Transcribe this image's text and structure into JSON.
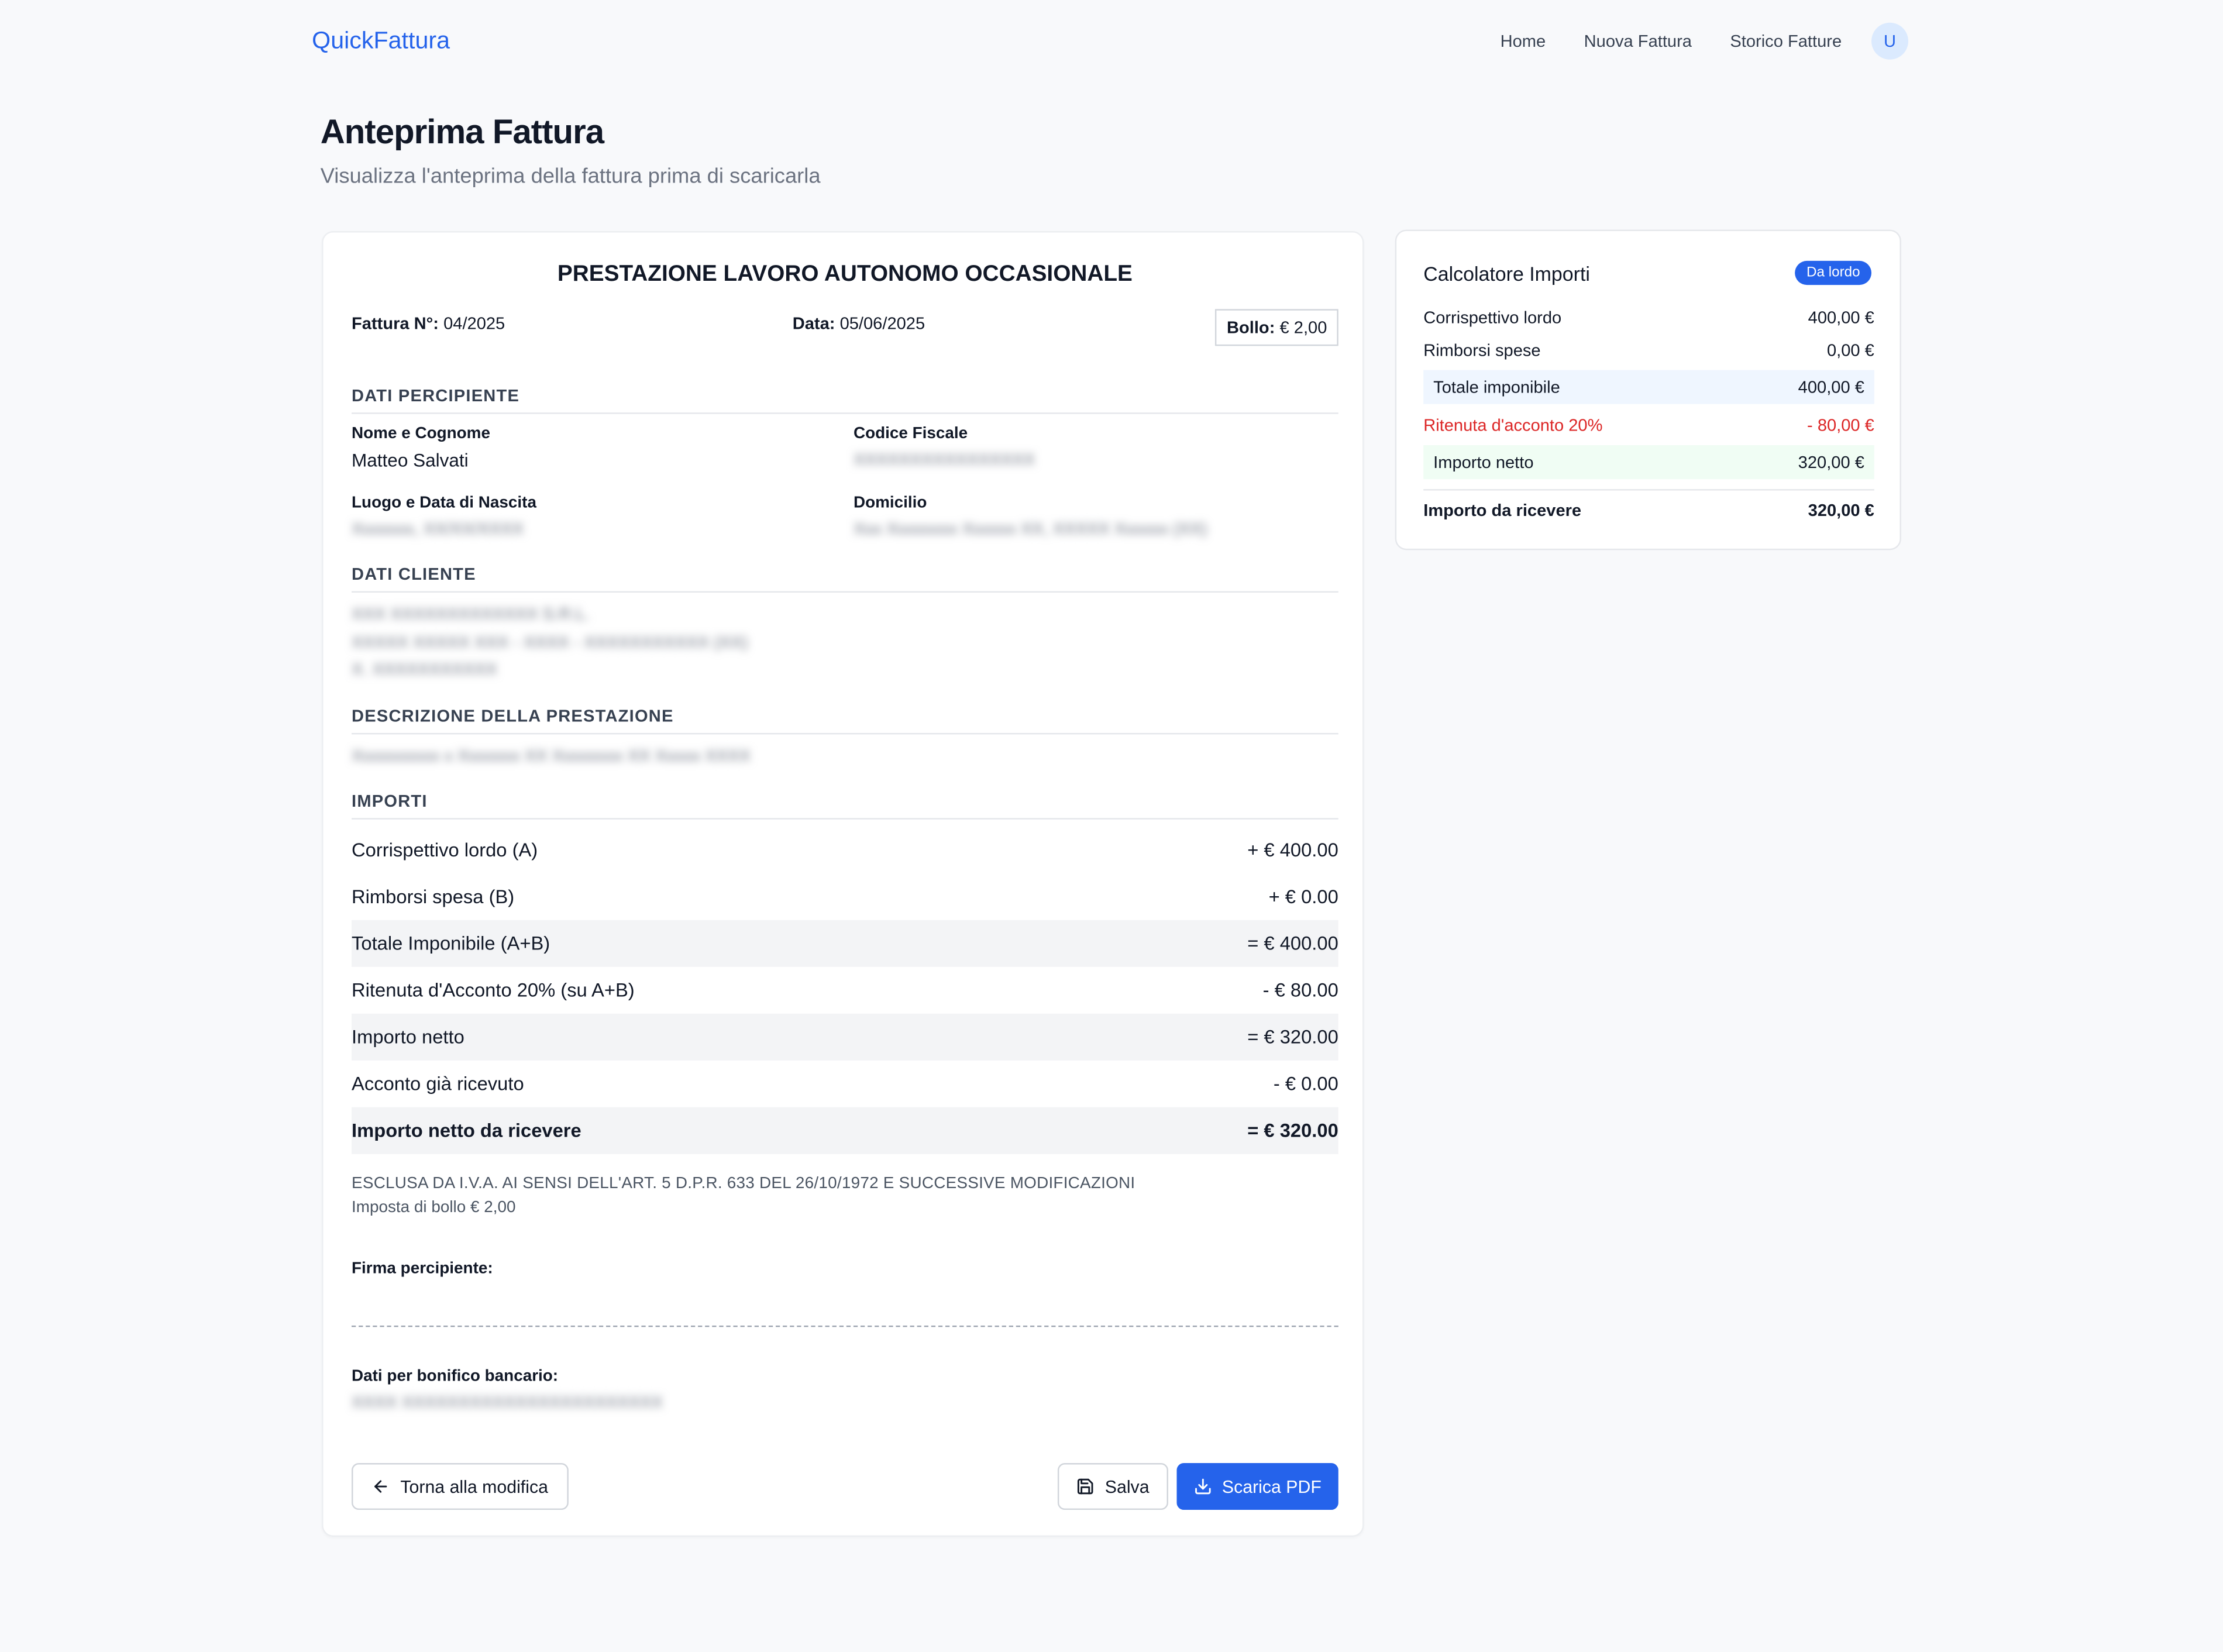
{
  "nav": {
    "brand": "QuickFattura",
    "links": [
      "Home",
      "Nuova Fattura",
      "Storico Fatture"
    ],
    "avatar_initial": "U"
  },
  "header": {
    "title": "Anteprima Fattura",
    "subtitle": "Visualizza l'anteprima della fattura prima di scaricarla"
  },
  "invoice": {
    "title": "PRESTAZIONE LAVORO AUTONOMO OCCASIONALE",
    "number_label": "Fattura N°:",
    "number": "04/2025",
    "date_label": "Data:",
    "date": "05/06/2025",
    "bollo_label": "Bollo:",
    "bollo": "€ 2,00",
    "section_percipiente": "DATI PERCIPIENTE",
    "name_label": "Nome e Cognome",
    "name": "Matteo Salvati",
    "cf_label": "Codice Fiscale",
    "birth_label": "Luogo e Data di Nascita",
    "domicile_label": "Domicilio",
    "section_cliente": "DATI CLIENTE",
    "section_descrizione": "DESCRIZIONE DELLA PRESTAZIONE",
    "section_importi": "IMPORTI",
    "rows": [
      {
        "label": "Corrispettivo lordo (A)",
        "value": "+ € 400.00"
      },
      {
        "label": "Rimborsi spesa (B)",
        "value": "+ € 0.00"
      },
      {
        "label": "Totale Imponibile (A+B)",
        "value": "= € 400.00"
      },
      {
        "label": "Ritenuta d'Acconto 20% (su A+B)",
        "value": "- € 80.00"
      },
      {
        "label": "Importo netto",
        "value": "= € 320.00"
      },
      {
        "label": "Acconto già ricevuto",
        "value": "- € 0.00"
      },
      {
        "label": "Importo netto da ricevere",
        "value": "= € 320.00"
      }
    ],
    "note_iva": "ESCLUSA DA I.V.A. AI SENSI DELL'ART. 5 D.P.R. 633 DEL 26/10/1972 E SUCCESSIVE MODIFICAZIONI",
    "note_bollo": "Imposta di bollo € 2,00",
    "firma_label": "Firma percipiente:",
    "bonifico_label": "Dati per bonifico bancario:"
  },
  "actions": {
    "back": "Torna alla modifica",
    "save": "Salva",
    "download": "Scarica PDF"
  },
  "calculator": {
    "title": "Calcolatore Importi",
    "badge": "Da lordo",
    "rows": [
      {
        "label": "Corrispettivo lordo",
        "value": "400,00 €"
      },
      {
        "label": "Rimborsi spese",
        "value": "0,00 €"
      },
      {
        "label": "Totale imponibile",
        "value": "400,00 €"
      },
      {
        "label": "Ritenuta d'acconto 20%",
        "value": "- 80,00 €"
      },
      {
        "label": "Importo netto",
        "value": "320,00 €"
      },
      {
        "label": "Importo da ricevere",
        "value": "320,00 €"
      }
    ]
  },
  "colors": {
    "accent": "#2563eb",
    "negative": "#dc2626",
    "highlight_blue": "#eff6ff",
    "highlight_green": "#f0fdf4"
  }
}
